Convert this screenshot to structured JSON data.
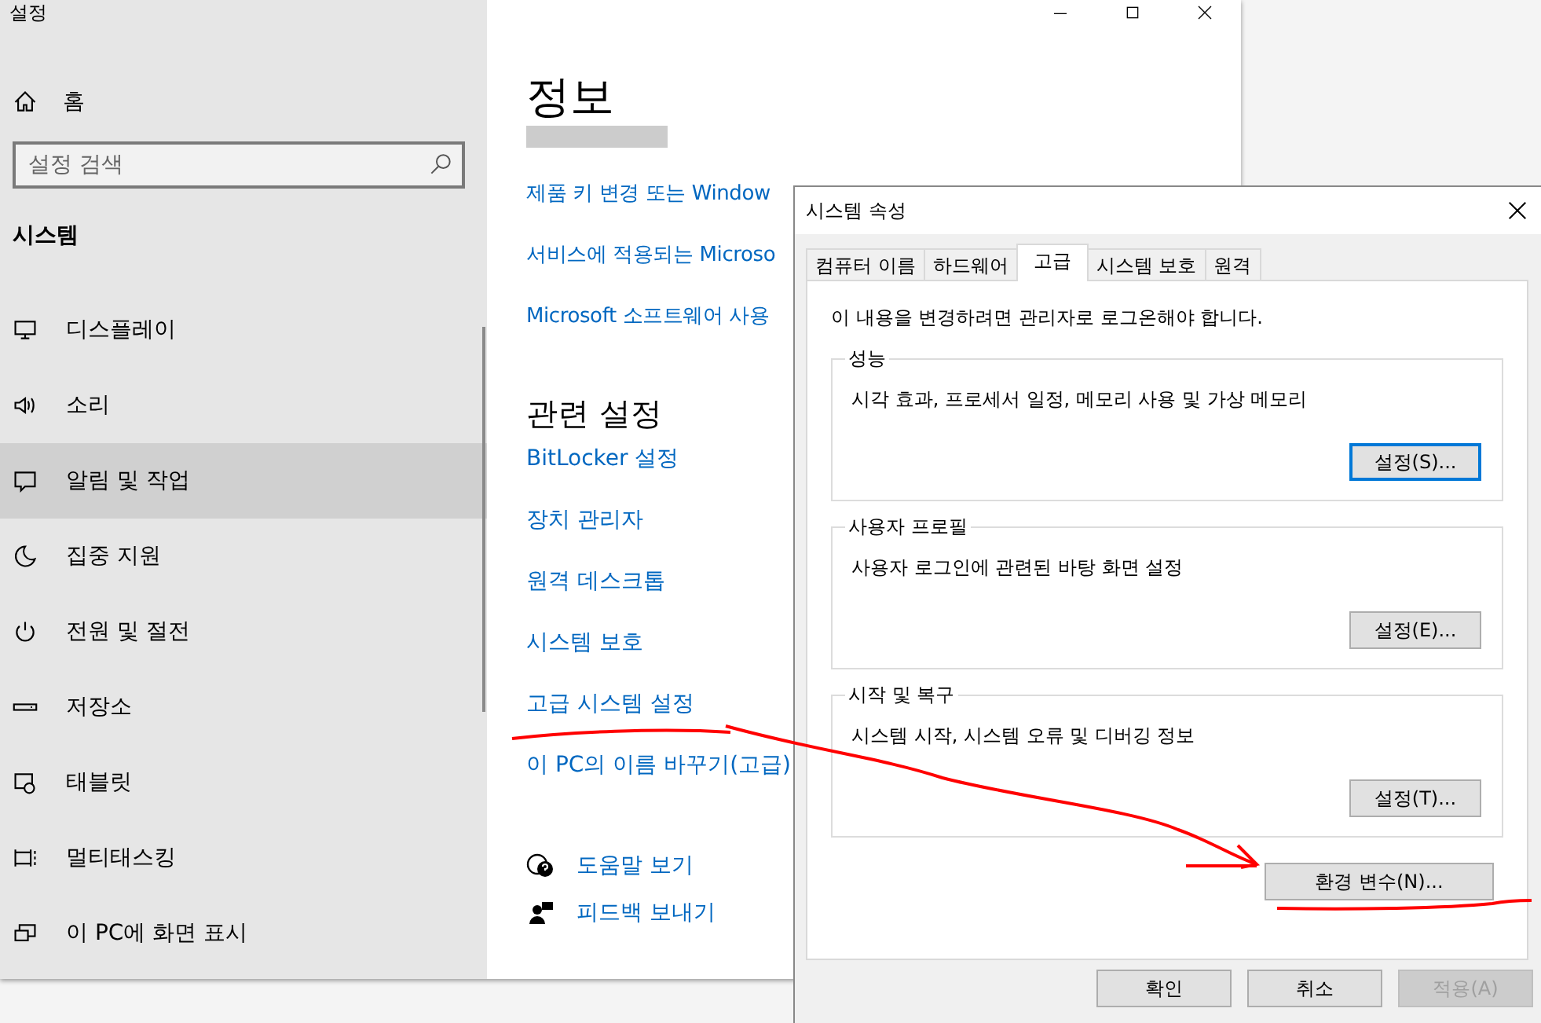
{
  "settings_window": {
    "title": "설정",
    "sidebar": {
      "home": "홈",
      "search": {
        "placeholder": "설정 검색"
      },
      "section": "시스템",
      "items": [
        {
          "label": "디스플레이",
          "kind": "display",
          "selected": false
        },
        {
          "label": "소리",
          "kind": "sound",
          "selected": false
        },
        {
          "label": "알림 및 작업",
          "kind": "notify",
          "selected": true
        },
        {
          "label": "집중 지원",
          "kind": "moon",
          "selected": false
        },
        {
          "label": "전원 및 절전",
          "kind": "power",
          "selected": false
        },
        {
          "label": "저장소",
          "kind": "storage",
          "selected": false
        },
        {
          "label": "태블릿",
          "kind": "tablet",
          "selected": false
        },
        {
          "label": "멀티태스킹",
          "kind": "multitask",
          "selected": false
        },
        {
          "label": "이 PC에 화면 표시",
          "kind": "project",
          "selected": false
        }
      ]
    },
    "content": {
      "heading": "정보",
      "links": [
        "제품 키 변경 또는 Window",
        "서비스에 적용되는 Microso",
        "Microsoft 소프트웨어 사용"
      ],
      "related_heading": "관련 설정",
      "related_links": [
        "BitLocker 설정",
        "장치 관리자",
        "원격 데스크톱",
        "시스템 보호",
        "고급 시스템 설정",
        "이 PC의 이름 바꾸기(고급)"
      ],
      "help": [
        {
          "label": "도움말 보기",
          "kind": "help"
        },
        {
          "label": "피드백 보내기",
          "kind": "feedback"
        }
      ]
    }
  },
  "dialog": {
    "title": "시스템 속성",
    "tabs": [
      {
        "label": "컴퓨터 이름",
        "selected": false
      },
      {
        "label": "하드웨어",
        "selected": false
      },
      {
        "label": "고급",
        "selected": true
      },
      {
        "label": "시스템 보호",
        "selected": false
      },
      {
        "label": "원격",
        "selected": false
      }
    ],
    "notice": "이 내용을 변경하려면 관리자로 로그온해야 합니다.",
    "groups": [
      {
        "title": "성능",
        "description": "시각 효과, 프로세서 일정, 메모리 사용 및 가상 메모리",
        "button": "설정(S)...",
        "focused": true
      },
      {
        "title": "사용자 프로필",
        "description": "사용자 로그인에 관련된 바탕 화면 설정",
        "button": "설정(E)...",
        "focused": false
      },
      {
        "title": "시작 및 복구",
        "description": "시스템 시작, 시스템 오류 및 디버깅 정보",
        "button": "설정(T)...",
        "focused": false
      }
    ],
    "env_button": "환경 변수(N)...",
    "footer_buttons": [
      {
        "label": "확인",
        "disabled": false
      },
      {
        "label": "취소",
        "disabled": false
      },
      {
        "label": "적용(A)",
        "disabled": true
      }
    ]
  }
}
